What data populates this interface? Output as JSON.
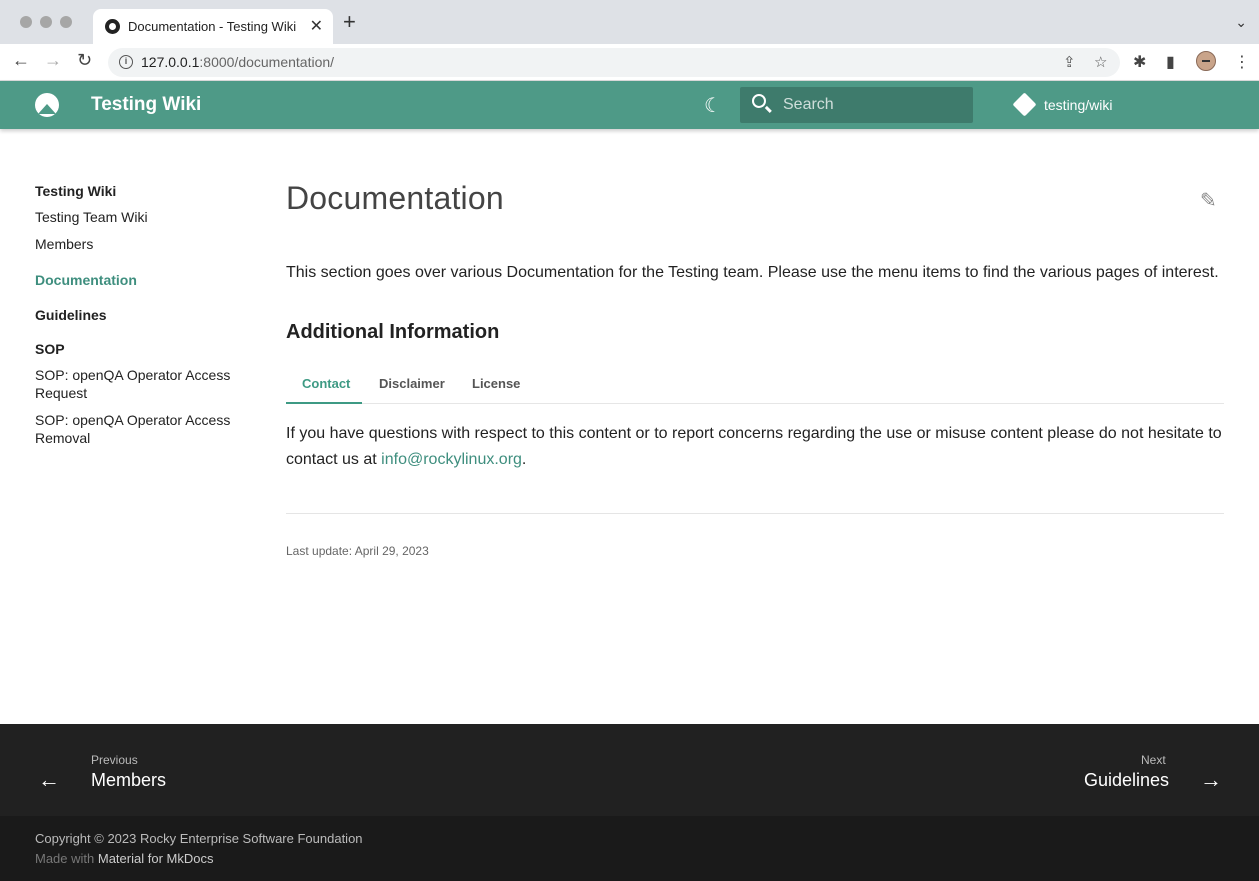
{
  "browser": {
    "tab_title": "Documentation - Testing Wiki",
    "url_host": "127.0.0.1",
    "url_rest": ":8000/documentation/"
  },
  "header": {
    "site_title": "Testing Wiki",
    "search_placeholder": "Search",
    "repo_label": "testing/wiki"
  },
  "sidebar": {
    "items": [
      {
        "label": "Testing Wiki",
        "style": "head"
      },
      {
        "label": "Testing Team Wiki",
        "style": "link"
      },
      {
        "label": "Members",
        "style": "link"
      },
      {
        "label": "Documentation",
        "style": "active"
      },
      {
        "label": "Guidelines",
        "style": "head"
      },
      {
        "label": "SOP",
        "style": "head"
      },
      {
        "label": "SOP: openQA Operator Access Request",
        "style": "link"
      },
      {
        "label": "SOP: openQA Operator Access Removal",
        "style": "link"
      }
    ]
  },
  "main": {
    "title": "Documentation",
    "intro": "This section goes over various Documentation for the Testing team. Please use the menu items to find the various pages of interest.",
    "section_title": "Additional Information",
    "tabs": [
      {
        "label": "Contact",
        "active": true
      },
      {
        "label": "Disclaimer",
        "active": false
      },
      {
        "label": "License",
        "active": false
      }
    ],
    "contact_text": "If you have questions with respect to this content or to report concerns regarding the use or misuse content please do not hesitate to contact us at ",
    "contact_email": "info@rockylinux.org",
    "contact_end": ".",
    "last_update": "Last update: April 29, 2023"
  },
  "footer": {
    "prev_label": "Previous",
    "prev_title": "Members",
    "next_label": "Next",
    "next_title": "Guidelines",
    "copyright": "Copyright © 2023 Rocky Enterprise Software Foundation",
    "made_with": "Made with",
    "made_with_link": "Material for MkDocs"
  },
  "colors": {
    "header": "#4e9a87",
    "accent": "#3e8e7e",
    "footer": "#212121"
  }
}
